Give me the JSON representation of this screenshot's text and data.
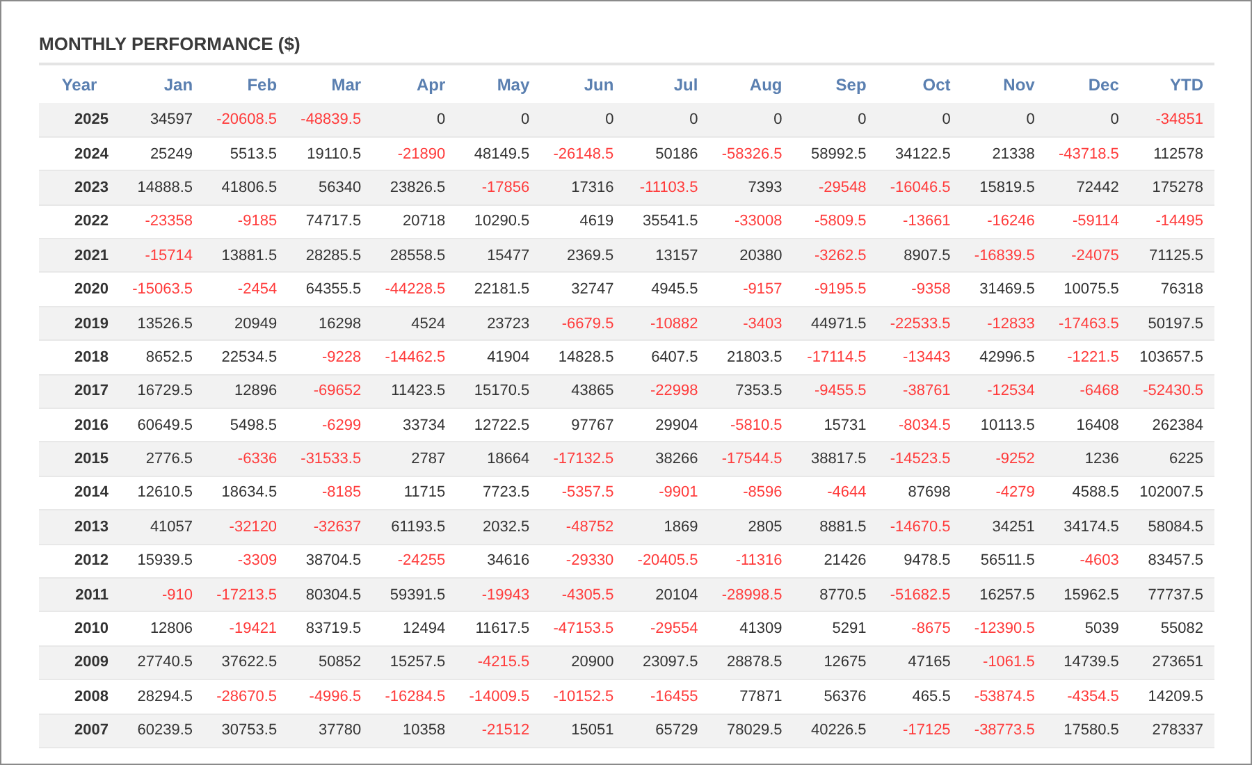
{
  "title": "MONTHLY PERFORMANCE ($)",
  "columns": [
    "Year",
    "Jan",
    "Feb",
    "Mar",
    "Apr",
    "May",
    "Jun",
    "Jul",
    "Aug",
    "Sep",
    "Oct",
    "Nov",
    "Dec",
    "YTD"
  ],
  "rows": [
    {
      "year": "2025",
      "cells": [
        {
          "value": "34597",
          "negative": false
        },
        {
          "value": "-20608.5",
          "negative": true
        },
        {
          "value": "-48839.5",
          "negative": true
        },
        {
          "value": "0",
          "negative": false
        },
        {
          "value": "0",
          "negative": false
        },
        {
          "value": "0",
          "negative": false
        },
        {
          "value": "0",
          "negative": false
        },
        {
          "value": "0",
          "negative": false
        },
        {
          "value": "0",
          "negative": false
        },
        {
          "value": "0",
          "negative": false
        },
        {
          "value": "0",
          "negative": false
        },
        {
          "value": "0",
          "negative": false
        },
        {
          "value": "-34851",
          "negative": true
        }
      ]
    },
    {
      "year": "2024",
      "cells": [
        {
          "value": "25249",
          "negative": false
        },
        {
          "value": "5513.5",
          "negative": false
        },
        {
          "value": "19110.5",
          "negative": false
        },
        {
          "value": "-21890",
          "negative": true
        },
        {
          "value": "48149.5",
          "negative": false
        },
        {
          "value": "-26148.5",
          "negative": true
        },
        {
          "value": "50186",
          "negative": false
        },
        {
          "value": "-58326.5",
          "negative": true
        },
        {
          "value": "58992.5",
          "negative": false
        },
        {
          "value": "34122.5",
          "negative": false
        },
        {
          "value": "21338",
          "negative": false
        },
        {
          "value": "-43718.5",
          "negative": true
        },
        {
          "value": "112578",
          "negative": false
        }
      ]
    },
    {
      "year": "2023",
      "cells": [
        {
          "value": "14888.5",
          "negative": false
        },
        {
          "value": "41806.5",
          "negative": false
        },
        {
          "value": "56340",
          "negative": false
        },
        {
          "value": "23826.5",
          "negative": false
        },
        {
          "value": "-17856",
          "negative": true
        },
        {
          "value": "17316",
          "negative": false
        },
        {
          "value": "-11103.5",
          "negative": true
        },
        {
          "value": "7393",
          "negative": false
        },
        {
          "value": "-29548",
          "negative": true
        },
        {
          "value": "-16046.5",
          "negative": true
        },
        {
          "value": "15819.5",
          "negative": false
        },
        {
          "value": "72442",
          "negative": false
        },
        {
          "value": "175278",
          "negative": false
        }
      ]
    },
    {
      "year": "2022",
      "cells": [
        {
          "value": "-23358",
          "negative": true
        },
        {
          "value": "-9185",
          "negative": true
        },
        {
          "value": "74717.5",
          "negative": false
        },
        {
          "value": "20718",
          "negative": false
        },
        {
          "value": "10290.5",
          "negative": false
        },
        {
          "value": "4619",
          "negative": false
        },
        {
          "value": "35541.5",
          "negative": false
        },
        {
          "value": "-33008",
          "negative": true
        },
        {
          "value": "-5809.5",
          "negative": true
        },
        {
          "value": "-13661",
          "negative": true
        },
        {
          "value": "-16246",
          "negative": true
        },
        {
          "value": "-59114",
          "negative": true
        },
        {
          "value": "-14495",
          "negative": true
        }
      ]
    },
    {
      "year": "2021",
      "cells": [
        {
          "value": "-15714",
          "negative": true
        },
        {
          "value": "13881.5",
          "negative": false
        },
        {
          "value": "28285.5",
          "negative": false
        },
        {
          "value": "28558.5",
          "negative": false
        },
        {
          "value": "15477",
          "negative": false
        },
        {
          "value": "2369.5",
          "negative": false
        },
        {
          "value": "13157",
          "negative": false
        },
        {
          "value": "20380",
          "negative": false
        },
        {
          "value": "-3262.5",
          "negative": true
        },
        {
          "value": "8907.5",
          "negative": false
        },
        {
          "value": "-16839.5",
          "negative": true
        },
        {
          "value": "-24075",
          "negative": true
        },
        {
          "value": "71125.5",
          "negative": false
        }
      ]
    },
    {
      "year": "2020",
      "cells": [
        {
          "value": "-15063.5",
          "negative": true
        },
        {
          "value": "-2454",
          "negative": true
        },
        {
          "value": "64355.5",
          "negative": false
        },
        {
          "value": "-44228.5",
          "negative": true
        },
        {
          "value": "22181.5",
          "negative": false
        },
        {
          "value": "32747",
          "negative": false
        },
        {
          "value": "4945.5",
          "negative": false
        },
        {
          "value": "-9157",
          "negative": true
        },
        {
          "value": "-9195.5",
          "negative": true
        },
        {
          "value": "-9358",
          "negative": true
        },
        {
          "value": "31469.5",
          "negative": false
        },
        {
          "value": "10075.5",
          "negative": false
        },
        {
          "value": "76318",
          "negative": false
        }
      ]
    },
    {
      "year": "2019",
      "cells": [
        {
          "value": "13526.5",
          "negative": false
        },
        {
          "value": "20949",
          "negative": false
        },
        {
          "value": "16298",
          "negative": false
        },
        {
          "value": "4524",
          "negative": false
        },
        {
          "value": "23723",
          "negative": false
        },
        {
          "value": "-6679.5",
          "negative": true
        },
        {
          "value": "-10882",
          "negative": true
        },
        {
          "value": "-3403",
          "negative": true
        },
        {
          "value": "44971.5",
          "negative": false
        },
        {
          "value": "-22533.5",
          "negative": true
        },
        {
          "value": "-12833",
          "negative": true
        },
        {
          "value": "-17463.5",
          "negative": true
        },
        {
          "value": "50197.5",
          "negative": false
        }
      ]
    },
    {
      "year": "2018",
      "cells": [
        {
          "value": "8652.5",
          "negative": false
        },
        {
          "value": "22534.5",
          "negative": false
        },
        {
          "value": "-9228",
          "negative": true
        },
        {
          "value": "-14462.5",
          "negative": true
        },
        {
          "value": "41904",
          "negative": false
        },
        {
          "value": "14828.5",
          "negative": false
        },
        {
          "value": "6407.5",
          "negative": false
        },
        {
          "value": "21803.5",
          "negative": false
        },
        {
          "value": "-17114.5",
          "negative": true
        },
        {
          "value": "-13443",
          "negative": true
        },
        {
          "value": "42996.5",
          "negative": false
        },
        {
          "value": "-1221.5",
          "negative": true
        },
        {
          "value": "103657.5",
          "negative": false
        }
      ]
    },
    {
      "year": "2017",
      "cells": [
        {
          "value": "16729.5",
          "negative": false
        },
        {
          "value": "12896",
          "negative": false
        },
        {
          "value": "-69652",
          "negative": true
        },
        {
          "value": "11423.5",
          "negative": false
        },
        {
          "value": "15170.5",
          "negative": false
        },
        {
          "value": "43865",
          "negative": false
        },
        {
          "value": "-22998",
          "negative": true
        },
        {
          "value": "7353.5",
          "negative": false
        },
        {
          "value": "-9455.5",
          "negative": true
        },
        {
          "value": "-38761",
          "negative": true
        },
        {
          "value": "-12534",
          "negative": true
        },
        {
          "value": "-6468",
          "negative": true
        },
        {
          "value": "-52430.5",
          "negative": true
        }
      ]
    },
    {
      "year": "2016",
      "cells": [
        {
          "value": "60649.5",
          "negative": false
        },
        {
          "value": "5498.5",
          "negative": false
        },
        {
          "value": "-6299",
          "negative": true
        },
        {
          "value": "33734",
          "negative": false
        },
        {
          "value": "12722.5",
          "negative": false
        },
        {
          "value": "97767",
          "negative": false
        },
        {
          "value": "29904",
          "negative": false
        },
        {
          "value": "-5810.5",
          "negative": true
        },
        {
          "value": "15731",
          "negative": false
        },
        {
          "value": "-8034.5",
          "negative": true
        },
        {
          "value": "10113.5",
          "negative": false
        },
        {
          "value": "16408",
          "negative": false
        },
        {
          "value": "262384",
          "negative": false
        }
      ]
    },
    {
      "year": "2015",
      "cells": [
        {
          "value": "2776.5",
          "negative": false
        },
        {
          "value": "-6336",
          "negative": true
        },
        {
          "value": "-31533.5",
          "negative": true
        },
        {
          "value": "2787",
          "negative": false
        },
        {
          "value": "18664",
          "negative": false
        },
        {
          "value": "-17132.5",
          "negative": true
        },
        {
          "value": "38266",
          "negative": false
        },
        {
          "value": "-17544.5",
          "negative": true
        },
        {
          "value": "38817.5",
          "negative": false
        },
        {
          "value": "-14523.5",
          "negative": true
        },
        {
          "value": "-9252",
          "negative": true
        },
        {
          "value": "1236",
          "negative": false
        },
        {
          "value": "6225",
          "negative": false
        }
      ]
    },
    {
      "year": "2014",
      "cells": [
        {
          "value": "12610.5",
          "negative": false
        },
        {
          "value": "18634.5",
          "negative": false
        },
        {
          "value": "-8185",
          "negative": true
        },
        {
          "value": "11715",
          "negative": false
        },
        {
          "value": "7723.5",
          "negative": false
        },
        {
          "value": "-5357.5",
          "negative": true
        },
        {
          "value": "-9901",
          "negative": true
        },
        {
          "value": "-8596",
          "negative": true
        },
        {
          "value": "-4644",
          "negative": true
        },
        {
          "value": "87698",
          "negative": false
        },
        {
          "value": "-4279",
          "negative": true
        },
        {
          "value": "4588.5",
          "negative": false
        },
        {
          "value": "102007.5",
          "negative": false
        }
      ]
    },
    {
      "year": "2013",
      "cells": [
        {
          "value": "41057",
          "negative": false
        },
        {
          "value": "-32120",
          "negative": true
        },
        {
          "value": "-32637",
          "negative": true
        },
        {
          "value": "61193.5",
          "negative": false
        },
        {
          "value": "2032.5",
          "negative": false
        },
        {
          "value": "-48752",
          "negative": true
        },
        {
          "value": "1869",
          "negative": false
        },
        {
          "value": "2805",
          "negative": false
        },
        {
          "value": "8881.5",
          "negative": false
        },
        {
          "value": "-14670.5",
          "negative": true
        },
        {
          "value": "34251",
          "negative": false
        },
        {
          "value": "34174.5",
          "negative": false
        },
        {
          "value": "58084.5",
          "negative": false
        }
      ]
    },
    {
      "year": "2012",
      "cells": [
        {
          "value": "15939.5",
          "negative": false
        },
        {
          "value": "-3309",
          "negative": true
        },
        {
          "value": "38704.5",
          "negative": false
        },
        {
          "value": "-24255",
          "negative": true
        },
        {
          "value": "34616",
          "negative": false
        },
        {
          "value": "-29330",
          "negative": true
        },
        {
          "value": "-20405.5",
          "negative": true
        },
        {
          "value": "-11316",
          "negative": true
        },
        {
          "value": "21426",
          "negative": false
        },
        {
          "value": "9478.5",
          "negative": false
        },
        {
          "value": "56511.5",
          "negative": false
        },
        {
          "value": "-4603",
          "negative": true
        },
        {
          "value": "83457.5",
          "negative": false
        }
      ]
    },
    {
      "year": "2011",
      "cells": [
        {
          "value": "-910",
          "negative": true
        },
        {
          "value": "-17213.5",
          "negative": true
        },
        {
          "value": "80304.5",
          "negative": false
        },
        {
          "value": "59391.5",
          "negative": false
        },
        {
          "value": "-19943",
          "negative": true
        },
        {
          "value": "-4305.5",
          "negative": true
        },
        {
          "value": "20104",
          "negative": false
        },
        {
          "value": "-28998.5",
          "negative": true
        },
        {
          "value": "8770.5",
          "negative": false
        },
        {
          "value": "-51682.5",
          "negative": true
        },
        {
          "value": "16257.5",
          "negative": false
        },
        {
          "value": "15962.5",
          "negative": false
        },
        {
          "value": "77737.5",
          "negative": false
        }
      ]
    },
    {
      "year": "2010",
      "cells": [
        {
          "value": "12806",
          "negative": false
        },
        {
          "value": "-19421",
          "negative": true
        },
        {
          "value": "83719.5",
          "negative": false
        },
        {
          "value": "12494",
          "negative": false
        },
        {
          "value": "11617.5",
          "negative": false
        },
        {
          "value": "-47153.5",
          "negative": true
        },
        {
          "value": "-29554",
          "negative": true
        },
        {
          "value": "41309",
          "negative": false
        },
        {
          "value": "5291",
          "negative": false
        },
        {
          "value": "-8675",
          "negative": true
        },
        {
          "value": "-12390.5",
          "negative": true
        },
        {
          "value": "5039",
          "negative": false
        },
        {
          "value": "55082",
          "negative": false
        }
      ]
    },
    {
      "year": "2009",
      "cells": [
        {
          "value": "27740.5",
          "negative": false
        },
        {
          "value": "37622.5",
          "negative": false
        },
        {
          "value": "50852",
          "negative": false
        },
        {
          "value": "15257.5",
          "negative": false
        },
        {
          "value": "-4215.5",
          "negative": true
        },
        {
          "value": "20900",
          "negative": false
        },
        {
          "value": "23097.5",
          "negative": false
        },
        {
          "value": "28878.5",
          "negative": false
        },
        {
          "value": "12675",
          "negative": false
        },
        {
          "value": "47165",
          "negative": false
        },
        {
          "value": "-1061.5",
          "negative": true
        },
        {
          "value": "14739.5",
          "negative": false
        },
        {
          "value": "273651",
          "negative": false
        }
      ]
    },
    {
      "year": "2008",
      "cells": [
        {
          "value": "28294.5",
          "negative": false
        },
        {
          "value": "-28670.5",
          "negative": true
        },
        {
          "value": "-4996.5",
          "negative": true
        },
        {
          "value": "-16284.5",
          "negative": true
        },
        {
          "value": "-14009.5",
          "negative": true
        },
        {
          "value": "-10152.5",
          "negative": true
        },
        {
          "value": "-16455",
          "negative": true
        },
        {
          "value": "77871",
          "negative": false
        },
        {
          "value": "56376",
          "negative": false
        },
        {
          "value": "465.5",
          "negative": false
        },
        {
          "value": "-53874.5",
          "negative": true
        },
        {
          "value": "-4354.5",
          "negative": true
        },
        {
          "value": "14209.5",
          "negative": false
        }
      ]
    },
    {
      "year": "2007",
      "cells": [
        {
          "value": "60239.5",
          "negative": false
        },
        {
          "value": "30753.5",
          "negative": false
        },
        {
          "value": "37780",
          "negative": false
        },
        {
          "value": "10358",
          "negative": false
        },
        {
          "value": "-21512",
          "negative": true
        },
        {
          "value": "15051",
          "negative": false
        },
        {
          "value": "65729",
          "negative": false
        },
        {
          "value": "78029.5",
          "negative": false
        },
        {
          "value": "40226.5",
          "negative": false
        },
        {
          "value": "-17125",
          "negative": true
        },
        {
          "value": "-38773.5",
          "negative": true
        },
        {
          "value": "17580.5",
          "negative": false
        },
        {
          "value": "278337",
          "negative": false
        }
      ]
    }
  ]
}
